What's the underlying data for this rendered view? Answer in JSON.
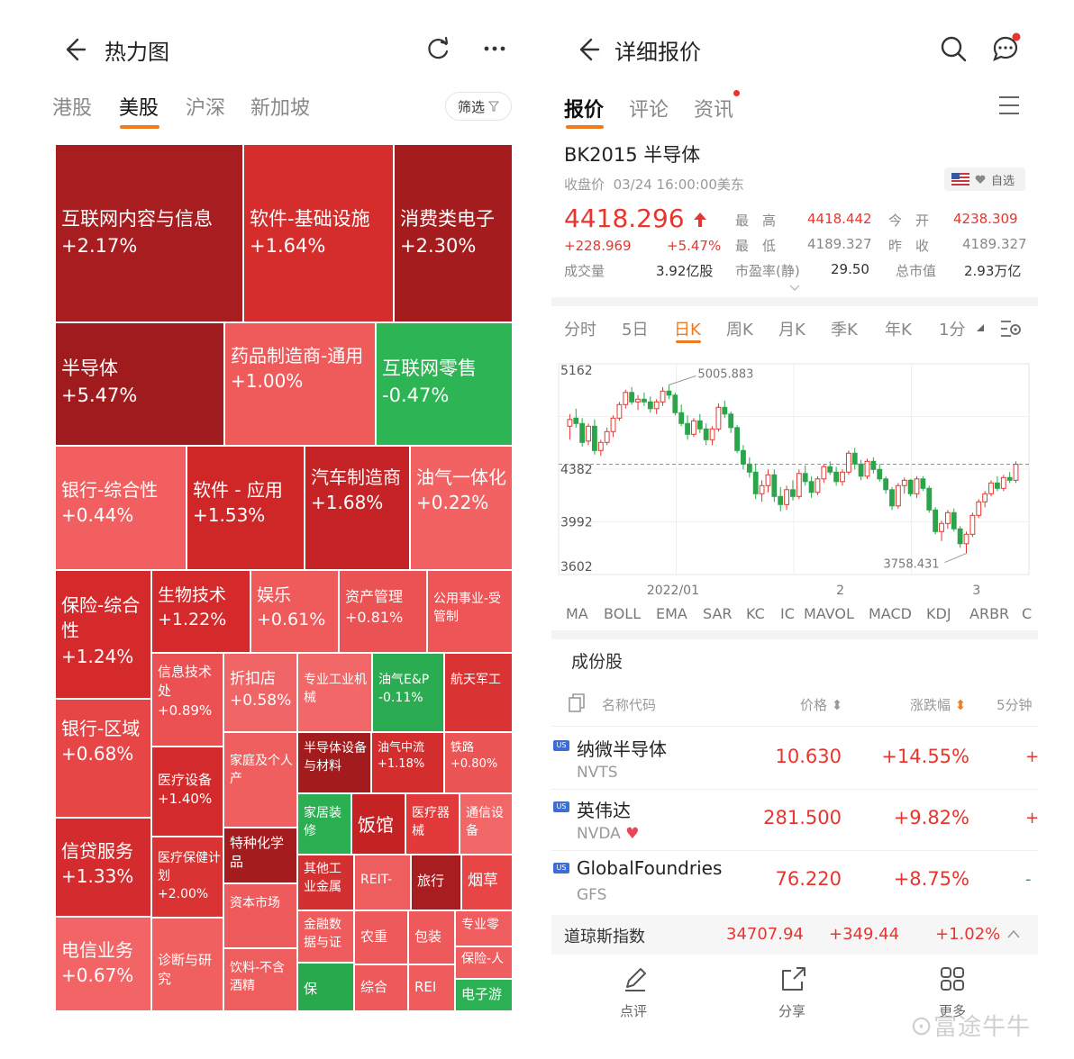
{
  "left": {
    "title": "热力图",
    "tabs": [
      {
        "label": "港股",
        "active": false
      },
      {
        "label": "美股",
        "active": true
      },
      {
        "label": "沪深",
        "active": false
      },
      {
        "label": "新加坡",
        "active": false
      }
    ],
    "filter_label": "筛选",
    "accent": "#f07a1e",
    "heatmap": [
      {
        "name": "互联网内容与信息",
        "change": "+2.17%"
      },
      {
        "name": "软件-基础设施",
        "change": "+1.64%"
      },
      {
        "name": "消费类电子",
        "change": "+2.30%"
      },
      {
        "name": "半导体",
        "change": "+5.47%"
      },
      {
        "name": "药品制造商-通用",
        "change": "+1.00%"
      },
      {
        "name": "互联网零售",
        "change": "-0.47%"
      },
      {
        "name": "银行-综合性",
        "change": "+0.44%"
      },
      {
        "name": "软件 - 应用",
        "change": "+1.53%"
      },
      {
        "name": "汽车制造商",
        "change": "+1.68%"
      },
      {
        "name": "油气一体化",
        "change": "+0.22%"
      },
      {
        "name": "保险-综合性",
        "change": "+1.24%"
      },
      {
        "name": "生物技术",
        "change": "+1.22%"
      },
      {
        "name": "娱乐",
        "change": "+0.61%"
      },
      {
        "name": "资产管理",
        "change": "+0.81%"
      },
      {
        "name": "公用事业-受管制",
        "change": ""
      },
      {
        "name": "信息技术处",
        "change": "+0.89%"
      },
      {
        "name": "折扣店",
        "change": "+0.58%"
      },
      {
        "name": "专业工业机械",
        "change": ""
      },
      {
        "name": "油气E&P",
        "change": "-0.11%"
      },
      {
        "name": "航天军工",
        "change": ""
      },
      {
        "name": "银行-区域",
        "change": "+0.68%"
      },
      {
        "name": "医疗设备",
        "change": "+1.40%"
      },
      {
        "name": "家庭及个人产",
        "change": ""
      },
      {
        "name": "半导体设备与材料",
        "change": ""
      },
      {
        "name": "油气中流",
        "change": "+1.18%"
      },
      {
        "name": "铁路",
        "change": "+0.80%"
      },
      {
        "name": "特种化学品",
        "change": ""
      },
      {
        "name": "家居装修",
        "change": ""
      },
      {
        "name": "饭馆",
        "change": ""
      },
      {
        "name": "医疗器械",
        "change": ""
      },
      {
        "name": "通信设备",
        "change": ""
      },
      {
        "name": "信贷服务",
        "change": "+1.33%"
      },
      {
        "name": "医疗保健计划",
        "change": "+2.00%"
      },
      {
        "name": "资本市场",
        "change": ""
      },
      {
        "name": "其他工业金属",
        "change": ""
      },
      {
        "name": "REIT-",
        "change": ""
      },
      {
        "name": "旅行",
        "change": ""
      },
      {
        "name": "烟草",
        "change": ""
      },
      {
        "name": "金融数据与证",
        "change": ""
      },
      {
        "name": "农重",
        "change": ""
      },
      {
        "name": "包装",
        "change": ""
      },
      {
        "name": "专业零",
        "change": ""
      },
      {
        "name": "电信业务",
        "change": "+0.67%"
      },
      {
        "name": "诊断与研究",
        "change": ""
      },
      {
        "name": "饮料-不含酒精",
        "change": ""
      },
      {
        "name": "保险-人",
        "change": ""
      },
      {
        "name": "保",
        "change": ""
      },
      {
        "name": "综合",
        "change": ""
      },
      {
        "name": "REI",
        "change": ""
      },
      {
        "name": "电子游",
        "change": ""
      }
    ]
  },
  "right": {
    "title": "详细报价",
    "tabs": [
      {
        "label": "报价",
        "active": true
      },
      {
        "label": "评论",
        "active": false
      },
      {
        "label": "资讯",
        "active": false
      }
    ],
    "stock_title": "BK2015 半导体",
    "close_label": "收盘价",
    "close_time": "03/24 16:00:00美东",
    "watch_label": "自选",
    "price": "4418.296",
    "change_abs": "+228.969",
    "change_pct": "+5.47%",
    "volume_label": "成交量",
    "volume": "3.92亿股",
    "quote_grid": [
      {
        "label": "最　高",
        "value": "4418.442"
      },
      {
        "label": "今　开",
        "value": "4238.309"
      },
      {
        "label": "最　低",
        "value": "4189.327"
      },
      {
        "label": "昨　收",
        "value": "4189.327"
      },
      {
        "label": "市盈率(静)",
        "value": "29.50"
      },
      {
        "label": "总市值",
        "value": "2.93万亿"
      }
    ],
    "periods": [
      "分时",
      "5日",
      "日K",
      "周K",
      "月K",
      "季K",
      "年K",
      "1分"
    ],
    "active_period": "日K",
    "indicators": [
      "MA",
      "BOLL",
      "EMA",
      "SAR",
      "KC",
      "IC",
      "MAVOL",
      "MACD",
      "KDJ",
      "ARBR",
      "C"
    ],
    "components_title": "成份股",
    "columns": [
      "名称代码",
      "价格",
      "涨跌幅",
      "5分钟"
    ],
    "components": [
      {
        "name": "纳微半导体",
        "code": "NVTS",
        "price": "10.630",
        "change": "+14.55%",
        "m5": "+",
        "badge": "US"
      },
      {
        "name": "英伟达",
        "code": "NVDA",
        "price": "281.500",
        "change": "+9.82%",
        "m5": "+",
        "badge": "US"
      },
      {
        "name": "GlobalFoundries",
        "code": "GFS",
        "price": "76.220",
        "change": "+8.75%",
        "m5": "-",
        "badge": "US"
      }
    ],
    "index_bar": {
      "name": "道琼斯指数",
      "value": "34707.94",
      "change": "+349.44",
      "pct": "+1.02%"
    },
    "bottom_actions": [
      "点评",
      "分享",
      "更多"
    ],
    "watermark": "富途牛牛",
    "colors": {
      "up": "#e8352f",
      "down": "#2aa54a",
      "accent": "#f07a1e"
    }
  },
  "chart_data": {
    "type": "candlestick",
    "y_ticks": [
      "5162",
      "4382",
      "3992",
      "3602"
    ],
    "ylim": [
      3602,
      5162
    ],
    "x_ticks": [
      "2022/01",
      "2",
      "3"
    ],
    "max_marker": "5005.883",
    "min_marker": "3758.431",
    "last_close": 4418.296,
    "candles": [
      [
        4700,
        4790,
        4600,
        4750
      ],
      [
        4760,
        4830,
        4690,
        4720
      ],
      [
        4720,
        4760,
        4550,
        4580
      ],
      [
        4590,
        4720,
        4560,
        4700
      ],
      [
        4700,
        4750,
        4490,
        4520
      ],
      [
        4520,
        4600,
        4480,
        4580
      ],
      [
        4580,
        4690,
        4560,
        4660
      ],
      [
        4660,
        4780,
        4620,
        4760
      ],
      [
        4760,
        4880,
        4740,
        4860
      ],
      [
        4860,
        4970,
        4830,
        4950
      ],
      [
        4950,
        4990,
        4860,
        4880
      ],
      [
        4880,
        4930,
        4820,
        4900
      ],
      [
        4900,
        4950,
        4850,
        4880
      ],
      [
        4880,
        4920,
        4800,
        4830
      ],
      [
        4830,
        4900,
        4790,
        4880
      ],
      [
        4880,
        4990,
        4850,
        4960
      ],
      [
        4960,
        5006,
        4900,
        4930
      ],
      [
        4930,
        4950,
        4780,
        4800
      ],
      [
        4800,
        4860,
        4700,
        4720
      ],
      [
        4720,
        4780,
        4600,
        4640
      ],
      [
        4640,
        4760,
        4620,
        4740
      ],
      [
        4740,
        4790,
        4650,
        4680
      ],
      [
        4680,
        4720,
        4560,
        4600
      ],
      [
        4600,
        4700,
        4560,
        4680
      ],
      [
        4680,
        4870,
        4660,
        4840
      ],
      [
        4840,
        4890,
        4760,
        4790
      ],
      [
        4790,
        4810,
        4650,
        4690
      ],
      [
        4690,
        4710,
        4500,
        4520
      ],
      [
        4520,
        4560,
        4380,
        4420
      ],
      [
        4420,
        4470,
        4320,
        4360
      ],
      [
        4360,
        4420,
        4160,
        4200
      ],
      [
        4200,
        4300,
        4140,
        4260
      ],
      [
        4260,
        4380,
        4210,
        4340
      ],
      [
        4340,
        4380,
        4140,
        4180
      ],
      [
        4180,
        4250,
        4070,
        4120
      ],
      [
        4120,
        4260,
        4080,
        4230
      ],
      [
        4230,
        4300,
        4150,
        4180
      ],
      [
        4180,
        4380,
        4160,
        4350
      ],
      [
        4350,
        4410,
        4260,
        4290
      ],
      [
        4290,
        4330,
        4170,
        4210
      ],
      [
        4210,
        4330,
        4190,
        4310
      ],
      [
        4310,
        4420,
        4280,
        4400
      ],
      [
        4400,
        4440,
        4340,
        4360
      ],
      [
        4360,
        4400,
        4260,
        4290
      ],
      [
        4290,
        4380,
        4260,
        4360
      ],
      [
        4360,
        4520,
        4340,
        4500
      ],
      [
        4500,
        4540,
        4380,
        4420
      ],
      [
        4420,
        4450,
        4300,
        4330
      ],
      [
        4330,
        4460,
        4310,
        4440
      ],
      [
        4440,
        4470,
        4350,
        4380
      ],
      [
        4380,
        4420,
        4290,
        4310
      ],
      [
        4310,
        4330,
        4200,
        4230
      ],
      [
        4230,
        4250,
        4080,
        4110
      ],
      [
        4110,
        4280,
        4090,
        4260
      ],
      [
        4260,
        4320,
        4200,
        4300
      ],
      [
        4300,
        4310,
        4180,
        4200
      ],
      [
        4200,
        4330,
        4170,
        4310
      ],
      [
        4310,
        4330,
        4220,
        4240
      ],
      [
        4240,
        4260,
        4060,
        4080
      ],
      [
        4080,
        4100,
        3900,
        3920
      ],
      [
        3920,
        4000,
        3850,
        3980
      ],
      [
        3980,
        4080,
        3940,
        4060
      ],
      [
        4060,
        4090,
        3920,
        3940
      ],
      [
        3940,
        3960,
        3800,
        3830
      ],
      [
        3830,
        3920,
        3758,
        3900
      ],
      [
        3900,
        4060,
        3880,
        4040
      ],
      [
        4040,
        4160,
        4020,
        4140
      ],
      [
        4140,
        4220,
        4100,
        4200
      ],
      [
        4200,
        4300,
        4180,
        4280
      ],
      [
        4280,
        4330,
        4220,
        4240
      ],
      [
        4240,
        4340,
        4220,
        4320
      ],
      [
        4320,
        4360,
        4280,
        4300
      ],
      [
        4300,
        4440,
        4280,
        4418
      ]
    ]
  }
}
